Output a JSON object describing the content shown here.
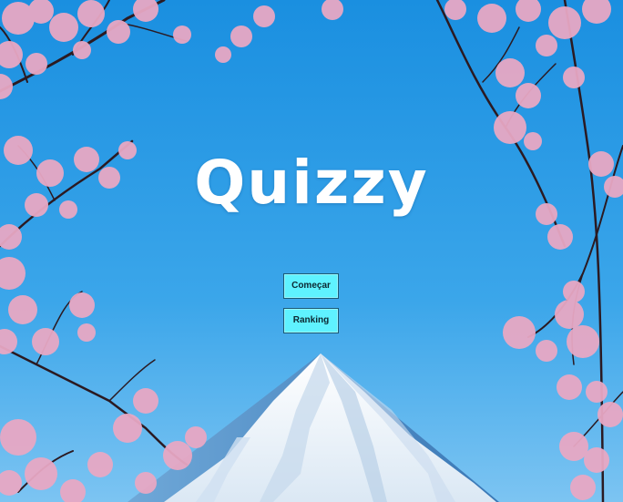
{
  "app": {
    "title": "Quizzy"
  },
  "menu": {
    "start_label": "Começar",
    "ranking_label": "Ranking"
  },
  "colors": {
    "sky_top": "#1a8fe0",
    "sky_bottom": "#7cc4f2",
    "button_fill": "#5ff2ff",
    "button_border": "#1d5a74",
    "blossom": "#e8a8c4",
    "mountain_snow": "#f4f8fc",
    "mountain_rock": "#2f6fae"
  },
  "background": {
    "icons": [
      "cherry-blossom-branches",
      "snow-capped-mountain"
    ]
  }
}
